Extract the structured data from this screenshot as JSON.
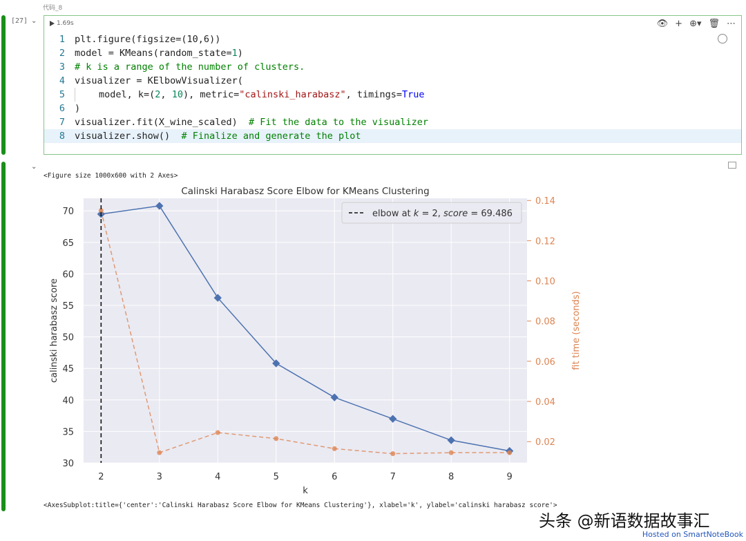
{
  "cell": {
    "label": "代码_8",
    "exec_count": "[27]",
    "run_time": "1.69s",
    "toolbar_icons": [
      "eye-icon",
      "plus-icon",
      "cell-options-icon",
      "trash-icon",
      "more-icon"
    ]
  },
  "code_lines": [
    {
      "n": "1",
      "active": false
    },
    {
      "n": "2",
      "active": false
    },
    {
      "n": "3",
      "active": false
    },
    {
      "n": "4",
      "active": false
    },
    {
      "n": "5",
      "active": false
    },
    {
      "n": "6",
      "active": false
    },
    {
      "n": "7",
      "active": false
    },
    {
      "n": "8",
      "active": true
    }
  ],
  "code_text": {
    "l1": "plt.figure(figsize=(10,6))",
    "l2a": "model = KMeans(random_state=",
    "l2n": "1",
    "l2b": ")",
    "l3": "# k is a range of the number of clusters.",
    "l4": "visualizer = KElbowVisualizer(",
    "l5a": "model, k=(",
    "l5n1": "2",
    "l5c": ", ",
    "l5n2": "10",
    "l5d": "), metric=",
    "l5s": "\"calinski_harabasz\"",
    "l5e": ", timings=",
    "l5k": "True",
    "l6": ")",
    "l7a": "visualizer.fit(X_wine_scaled)  ",
    "l7c": "# Fit the data to the visualizer",
    "l8a": "visualizer.show()  ",
    "l8c": "# Finalize and generate the plot"
  },
  "output": {
    "figure_size": "<Figure size 1000x600 with 2 Axes>",
    "axes_repr": "<AxesSubplot:title={'center':'Calinski Harabasz Score Elbow for KMeans Clustering'}, xlabel='k', ylabel='calinski harabasz score'>"
  },
  "watermark": "头条 @新语数据故事汇",
  "hosted_by": "Hosted on SmartNoteBook",
  "chart_data": {
    "type": "line",
    "title": "Calinski Harabasz Score Elbow for KMeans Clustering",
    "xlabel": "k",
    "ylabel": "calinski harabasz score",
    "y2label": "fit time (seconds)",
    "x": [
      2,
      3,
      4,
      5,
      6,
      7,
      8,
      9
    ],
    "xlim": [
      1.7,
      9.3
    ],
    "ylim": [
      30,
      72
    ],
    "y2lim": [
      0.0094,
      0.1411
    ],
    "yticks": [
      30,
      35,
      40,
      45,
      50,
      55,
      60,
      65,
      70
    ],
    "y2ticks": [
      0.02,
      0.04,
      0.06,
      0.08,
      0.1,
      0.12,
      0.14
    ],
    "y2tick_labels": [
      "0.02",
      "0.04",
      "0.06",
      "0.08",
      "0.10",
      "0.12",
      "0.14"
    ],
    "series": [
      {
        "name": "calinski harabasz score",
        "axis": "left",
        "color": "#4c72b0",
        "values": [
          69.49,
          70.8,
          56.2,
          45.8,
          40.4,
          37.0,
          33.6,
          31.9
        ]
      },
      {
        "name": "fit time",
        "axis": "right",
        "color": "#dd8452",
        "values": [
          0.135,
          0.0145,
          0.0245,
          0.0215,
          0.0165,
          0.014,
          0.0145,
          0.0145
        ]
      }
    ],
    "elbow": {
      "k": 2,
      "label": "elbow at $k = 2$, $score = 69.486$",
      "legend_parts": [
        "elbow at ",
        "k",
        " = 2, ",
        "score",
        " = 69.486"
      ]
    },
    "background": "#eaeaf2",
    "grid": true,
    "legend_location": "top-right"
  }
}
